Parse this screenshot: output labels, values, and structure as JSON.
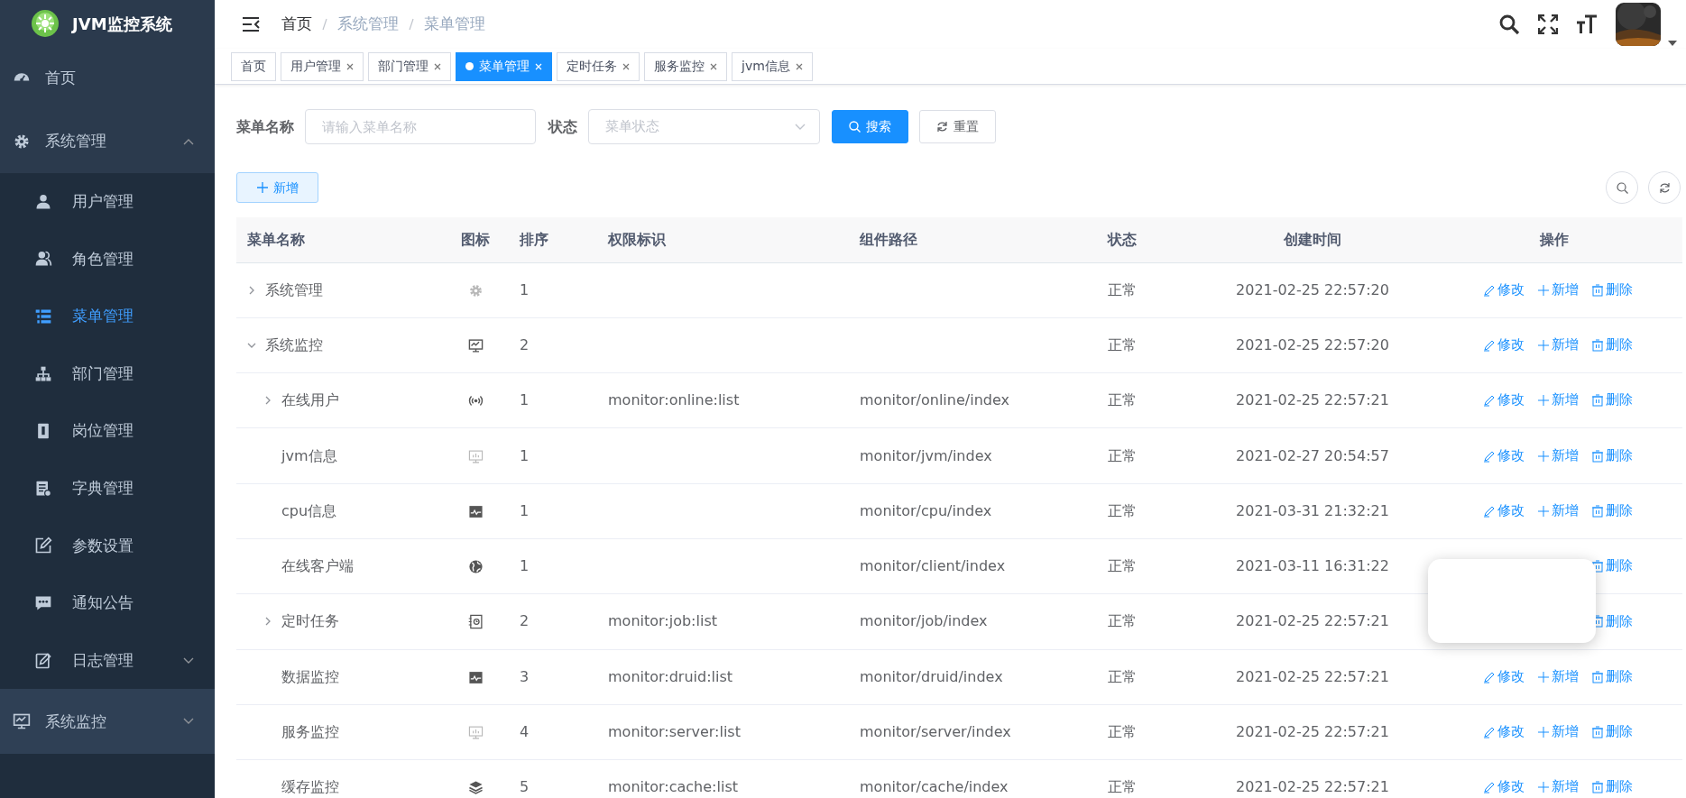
{
  "sidebar": {
    "logo": "JVM监控系统",
    "items": [
      {
        "label": "首页",
        "selected": false,
        "hovered": false
      },
      {
        "label": "系统管理",
        "selected": false,
        "hovered": false,
        "expanded": true,
        "children": [
          {
            "label": "用户管理",
            "selected": false
          },
          {
            "label": "角色管理",
            "selected": false
          },
          {
            "label": "菜单管理",
            "selected": true
          },
          {
            "label": "部门管理",
            "selected": false
          },
          {
            "label": "岗位管理",
            "selected": false
          },
          {
            "label": "字典管理",
            "selected": false
          },
          {
            "label": "参数设置",
            "selected": false
          },
          {
            "label": "通知公告",
            "selected": false
          },
          {
            "label": "日志管理",
            "selected": false,
            "expanded": false
          }
        ]
      },
      {
        "label": "系统监控",
        "selected": false,
        "hovered": true,
        "expanded": false
      }
    ]
  },
  "header": {
    "breadcrumb": [
      {
        "label": "首页",
        "linked": true
      },
      {
        "label": "系统管理",
        "linked": false
      },
      {
        "label": "菜单管理",
        "linked": false
      }
    ]
  },
  "tags": [
    {
      "label": "首页",
      "selected": false,
      "closable": false
    },
    {
      "label": "用户管理",
      "selected": false,
      "closable": true
    },
    {
      "label": "部门管理",
      "selected": false,
      "closable": true
    },
    {
      "label": "菜单管理",
      "selected": true,
      "closable": true
    },
    {
      "label": "定时任务",
      "selected": false,
      "closable": true
    },
    {
      "label": "服务监控",
      "selected": false,
      "closable": true
    },
    {
      "label": "jvm信息",
      "selected": false,
      "closable": true
    }
  ],
  "search": {
    "fields": [
      {
        "label": "菜单名称",
        "kind": "text",
        "placeholder": "请输入菜单名称"
      },
      {
        "label": "状态",
        "kind": "select",
        "placeholder": "菜单状态"
      }
    ],
    "buttons": [
      {
        "label": "搜索",
        "kind": "primary"
      },
      {
        "label": "重置",
        "kind": "default"
      }
    ]
  },
  "toolbar": {
    "add_button": "新增"
  },
  "table": {
    "columns": [
      "菜单名称",
      "图标",
      "排序",
      "权限标识",
      "组件路径",
      "状态",
      "创建时间",
      "操作"
    ],
    "rows": [
      {
        "name": "系统管理",
        "expanded": false,
        "order": "1",
        "status": "正常",
        "created": "2021-02-25 22:57:20",
        "actions": [
          {
            "label": "修改",
            "kind": "edit"
          },
          {
            "label": "新增",
            "kind": "add"
          },
          {
            "label": "删除",
            "kind": "delete"
          }
        ]
      },
      {
        "name": "系统监控",
        "expanded": true,
        "order": "2",
        "status": "正常",
        "created": "2021-02-25 22:57:20",
        "actions": [
          {
            "label": "修改",
            "kind": "edit"
          },
          {
            "label": "新增",
            "kind": "add"
          },
          {
            "label": "删除",
            "kind": "delete"
          }
        ],
        "children": [
          {
            "name": "在线用户",
            "expanded": false,
            "order": "1",
            "perms": "monitor:online:list",
            "component": "monitor/online/index",
            "status": "正常",
            "created": "2021-02-25 22:57:21",
            "actions": [
              {
                "label": "修改",
                "kind": "edit"
              },
              {
                "label": "新增",
                "kind": "add"
              },
              {
                "label": "删除",
                "kind": "delete"
              }
            ]
          },
          {
            "name": "jvm信息",
            "order": "1",
            "component": "monitor/jvm/index",
            "status": "正常",
            "created": "2021-02-27 20:54:57",
            "actions": [
              {
                "label": "修改",
                "kind": "edit"
              },
              {
                "label": "新增",
                "kind": "add"
              },
              {
                "label": "删除",
                "kind": "delete"
              }
            ]
          },
          {
            "name": "cpu信息",
            "order": "1",
            "component": "monitor/cpu/index",
            "status": "正常",
            "created": "2021-03-31 21:32:21",
            "actions": [
              {
                "label": "修改",
                "kind": "edit"
              },
              {
                "label": "新增",
                "kind": "add"
              },
              {
                "label": "删除",
                "kind": "delete"
              }
            ]
          },
          {
            "name": "在线客户端",
            "order": "1",
            "component": "monitor/client/index",
            "status": "正常",
            "created": "2021-03-11 16:31:22",
            "actions": [
              {
                "label": "删除",
                "kind": "delete"
              }
            ]
          },
          {
            "name": "定时任务",
            "expanded": false,
            "order": "2",
            "perms": "monitor:job:list",
            "component": "monitor/job/index",
            "status": "正常",
            "created": "2021-02-25 22:57:21",
            "actions": [
              {
                "label": "删除",
                "kind": "delete"
              }
            ]
          },
          {
            "name": "数据监控",
            "order": "3",
            "perms": "monitor:druid:list",
            "component": "monitor/druid/index",
            "status": "正常",
            "created": "2021-02-25 22:57:21",
            "actions": [
              {
                "label": "修改",
                "kind": "edit"
              },
              {
                "label": "新增",
                "kind": "add"
              },
              {
                "label": "删除",
                "kind": "delete"
              }
            ]
          },
          {
            "name": "服务监控",
            "order": "4",
            "perms": "monitor:server:list",
            "component": "monitor/server/index",
            "status": "正常",
            "created": "2021-02-25 22:57:21",
            "actions": [
              {
                "label": "修改",
                "kind": "edit"
              },
              {
                "label": "新增",
                "kind": "add"
              },
              {
                "label": "删除",
                "kind": "delete"
              }
            ]
          },
          {
            "name": "缓存监控",
            "order": "5",
            "perms": "monitor:cache:list",
            "component": "monitor/cache/index",
            "status": "正常",
            "created": "2021-02-25 22:57:21",
            "actions": [
              {
                "label": "修改",
                "kind": "edit"
              },
              {
                "label": "新增",
                "kind": "add"
              },
              {
                "label": "删除",
                "kind": "delete"
              }
            ]
          }
        ]
      }
    ]
  }
}
